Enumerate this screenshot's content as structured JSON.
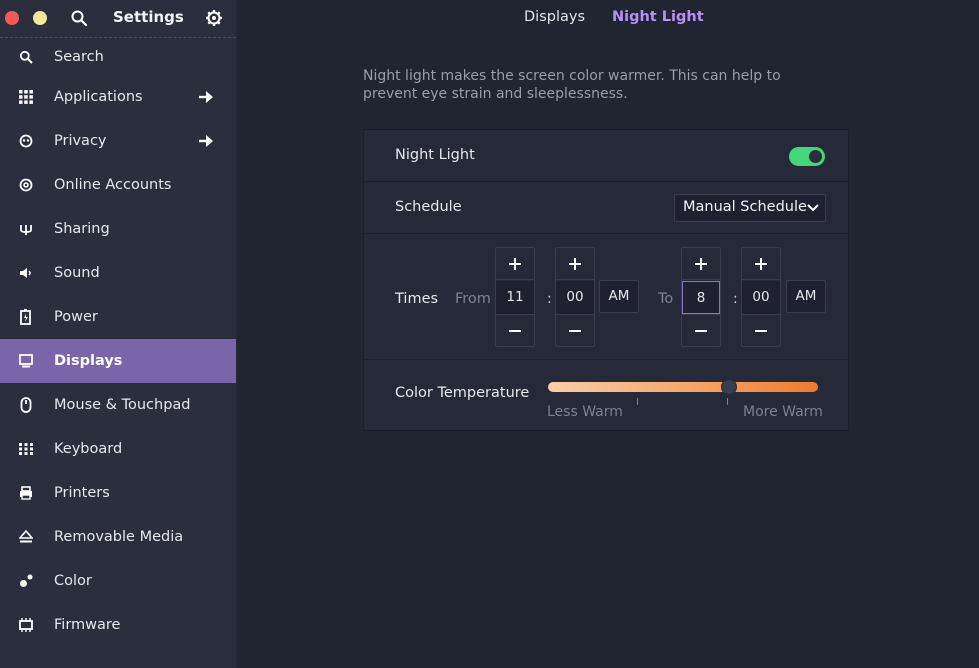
{
  "window": {
    "title": "Settings"
  },
  "sidebar": {
    "items": [
      {
        "label": "Search",
        "icon": "search-icon",
        "arrow": false
      },
      {
        "label": "Applications",
        "icon": "grid-icon",
        "arrow": true
      },
      {
        "label": "Privacy",
        "icon": "mask-icon",
        "arrow": true
      },
      {
        "label": "Online Accounts",
        "icon": "at-icon",
        "arrow": false
      },
      {
        "label": "Sharing",
        "icon": "share-icon",
        "arrow": false
      },
      {
        "label": "Sound",
        "icon": "speaker-icon",
        "arrow": false
      },
      {
        "label": "Power",
        "icon": "battery-icon",
        "arrow": false
      },
      {
        "label": "Displays",
        "icon": "monitor-icon",
        "arrow": false,
        "active": true
      },
      {
        "label": "Mouse & Touchpad",
        "icon": "mouse-icon",
        "arrow": false
      },
      {
        "label": "Keyboard",
        "icon": "keyboard-icon",
        "arrow": false
      },
      {
        "label": "Printers",
        "icon": "printer-icon",
        "arrow": false
      },
      {
        "label": "Removable Media",
        "icon": "eject-icon",
        "arrow": false
      },
      {
        "label": "Color",
        "icon": "palette-icon",
        "arrow": false
      },
      {
        "label": "Firmware",
        "icon": "chip-icon",
        "arrow": false
      }
    ]
  },
  "tabs": {
    "displays": "Displays",
    "night_light": "Night Light",
    "active": "night_light"
  },
  "night_light": {
    "description": "Night light makes the screen color warmer. This can help to prevent eye strain and sleeplessness.",
    "enable_label": "Night Light",
    "enabled": true,
    "schedule_label": "Schedule",
    "schedule_value": "Manual Schedule",
    "times_label": "Times",
    "from_label": "From",
    "from_hour": "11",
    "from_minute": "00",
    "from_period": "AM",
    "to_label": "To",
    "to_hour": "8",
    "to_minute": "00",
    "to_period": "AM",
    "colon": ":",
    "temperature_label": "Color Temperature",
    "temperature_min_label": "Less Warm",
    "temperature_max_label": "More Warm",
    "temperature_level": 0.67
  },
  "colors": {
    "accent": "#7a65ab",
    "tab_active": "#b790f3",
    "toggle_on": "#44d67a",
    "close": "#f25a5a",
    "minimize": "#f4e79a"
  }
}
